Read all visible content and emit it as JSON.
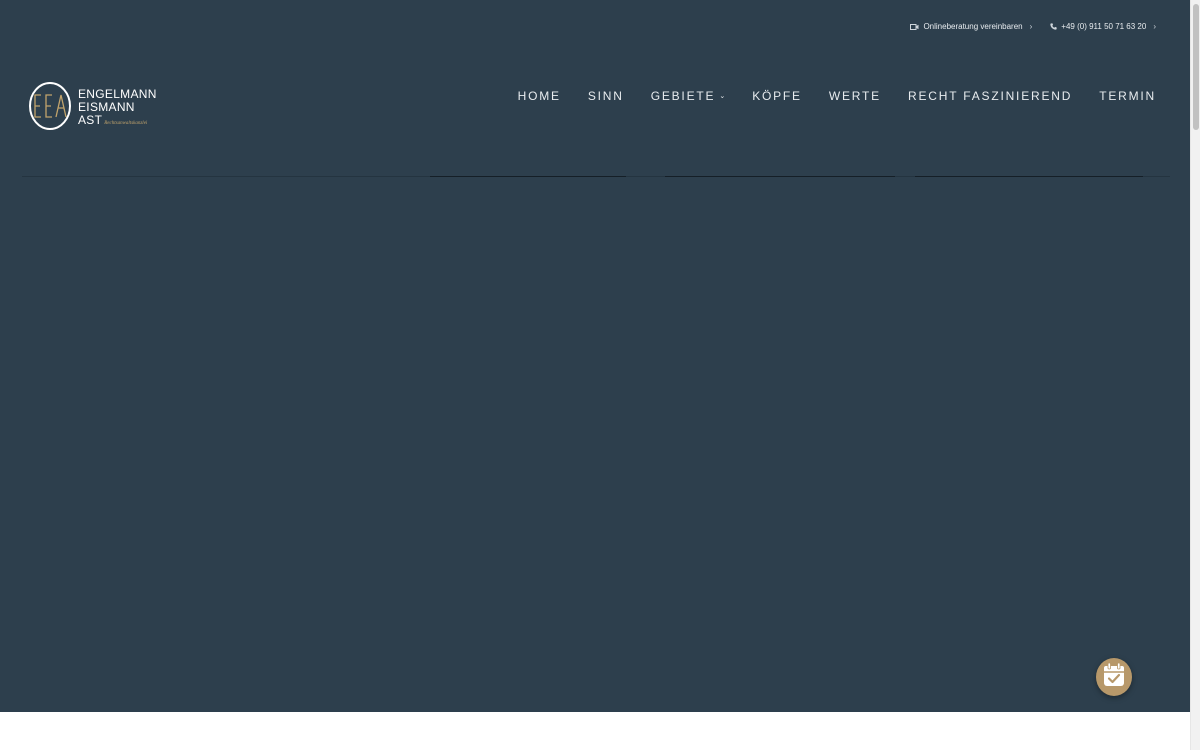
{
  "topbar": {
    "online_label": "Onlineberatung vereinbaren",
    "online_chevron": "›",
    "phone_label": "+49 (0) 911 50 71 63 20",
    "phone_chevron": "›"
  },
  "logo": {
    "line1": "ENGELMANN",
    "line2": "EISMANN",
    "line3": "AST",
    "tagline": "Rechtsanwaltskanzlei",
    "monogram": "EEA"
  },
  "nav": {
    "items": [
      {
        "label": "HOME"
      },
      {
        "label": "SINN"
      },
      {
        "label": "GEBIETE",
        "caret": "⌄"
      },
      {
        "label": "KÖPFE"
      },
      {
        "label": "WERTE"
      },
      {
        "label": "RECHT FASZINIEREND"
      },
      {
        "label": "TERMIN"
      }
    ]
  },
  "colors": {
    "hero_bg": "#2d3f4d",
    "accent_gold": "#b7986a",
    "text_light": "#e8ecef"
  },
  "icons": {
    "video": "video-camera-icon",
    "phone": "phone-icon",
    "calendar": "calendar-check-icon"
  }
}
